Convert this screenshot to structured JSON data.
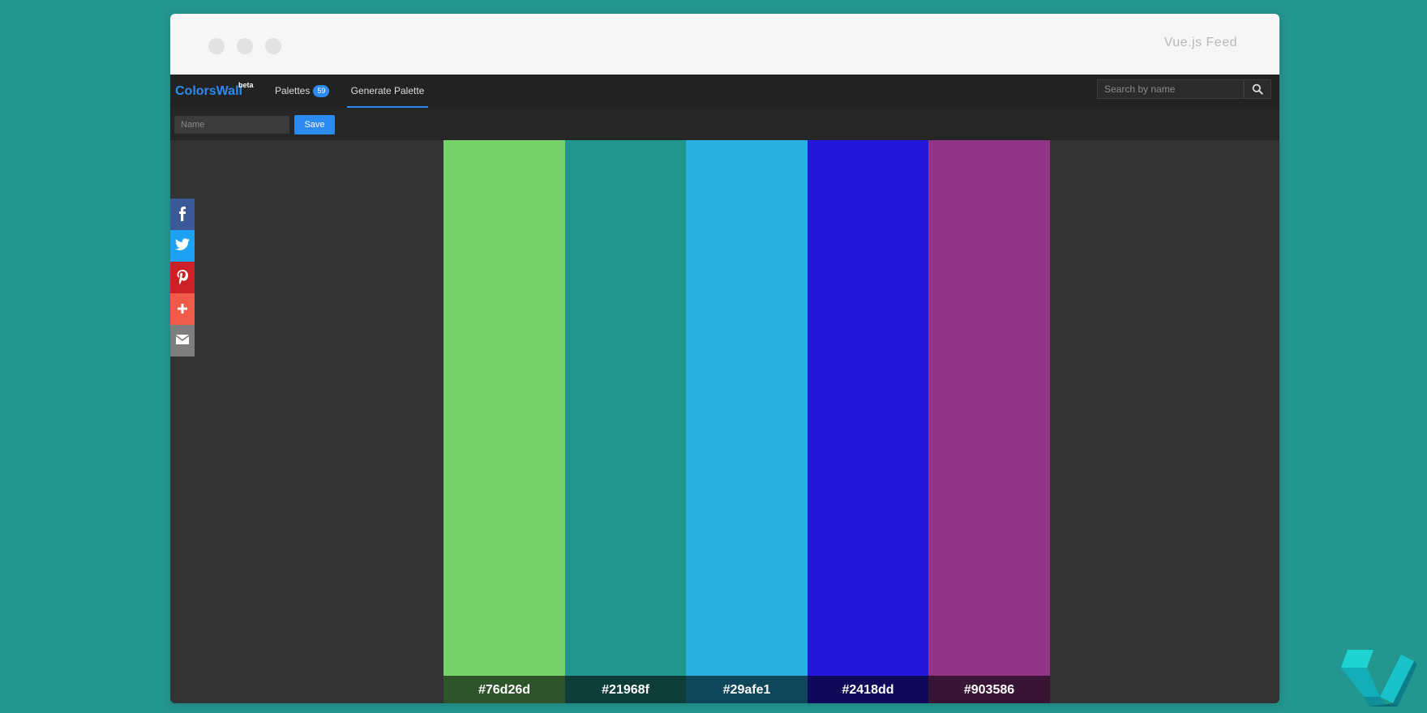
{
  "window": {
    "title": "Vue.js Feed"
  },
  "navbar": {
    "brand": "ColorsWall",
    "brand_sup": "beta",
    "palettes_label": "Palettes",
    "palettes_count": "59",
    "generate_label": "Generate Palette",
    "search_placeholder": "Search by name"
  },
  "toolbar": {
    "name_placeholder": "Name",
    "save_label": "Save"
  },
  "palette": {
    "colors": [
      {
        "hex": "#76d26d",
        "label": "#76d26d"
      },
      {
        "hex": "#21968f",
        "label": "#21968f"
      },
      {
        "hex": "#29afe1",
        "label": "#29afe1"
      },
      {
        "hex": "#2418dd",
        "label": "#2418dd"
      },
      {
        "hex": "#903586",
        "label": "#903586"
      }
    ]
  },
  "share": {
    "buttons": [
      {
        "icon": "facebook-icon",
        "color": "#3b5998"
      },
      {
        "icon": "twitter-icon",
        "color": "#1da1f2"
      },
      {
        "icon": "pinterest-icon",
        "color": "#cb2027"
      },
      {
        "icon": "plus-icon",
        "color": "#f05a49"
      },
      {
        "icon": "email-icon",
        "color": "#7e7e7e"
      }
    ]
  },
  "theme": {
    "background": "#23968f",
    "accent": "#2c8bf0"
  }
}
